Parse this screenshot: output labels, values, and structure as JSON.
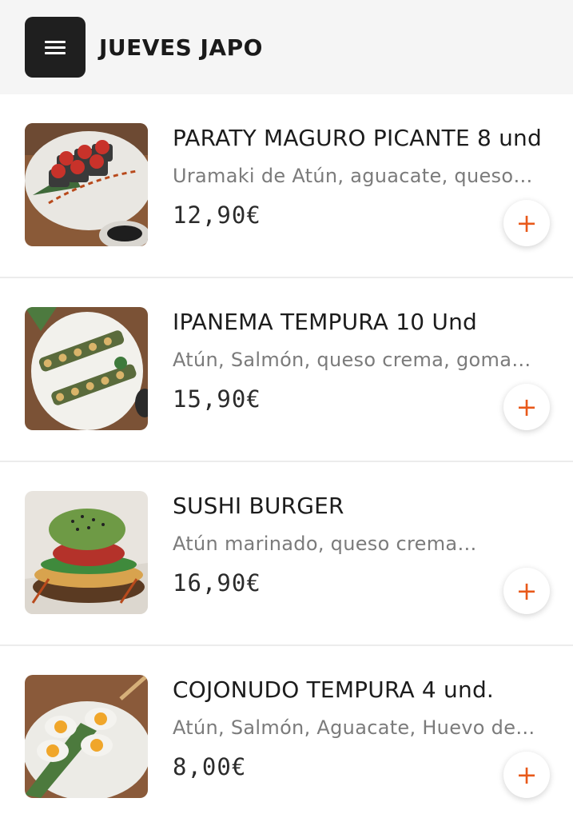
{
  "header": {
    "title": "JUEVES JAPO",
    "menu_icon": "hamburger-menu-icon"
  },
  "accent_color": "#e8591a",
  "items": [
    {
      "name": "PARATY MAGURO PICANTE 8 und",
      "description": "Uramaki de Atún, aguacate, queso…",
      "price": "12,90€",
      "add_label": "+"
    },
    {
      "name": "IPANEMA TEMPURA 10 Und",
      "description": "Atún, Salmón, queso crema, goma…",
      "price": "15,90€",
      "add_label": "+"
    },
    {
      "name": "SUSHI BURGER",
      "description": "Atún marinado, queso crema…",
      "price": "16,90€",
      "add_label": "+"
    },
    {
      "name": "COJONUDO TEMPURA 4 und.",
      "description": "Atún, Salmón, Aguacate, Huevo de…",
      "price": "8,00€",
      "add_label": "+"
    }
  ]
}
